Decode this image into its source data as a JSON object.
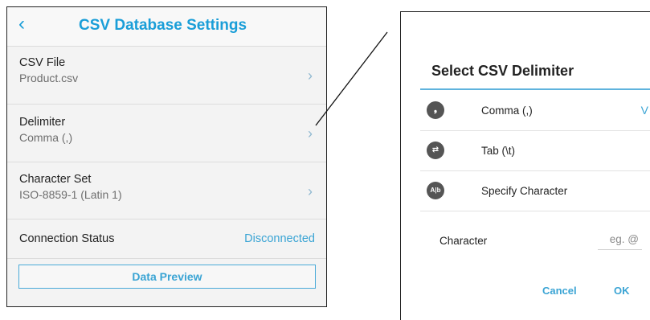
{
  "settings": {
    "title": "CSV Database Settings",
    "rows": [
      {
        "label": "CSV File",
        "value": "Product.csv"
      },
      {
        "label": "Delimiter",
        "value": "Comma (,)"
      },
      {
        "label": "Character Set",
        "value": "ISO-8859-1 (Latin 1)"
      }
    ],
    "connection": {
      "label": "Connection Status",
      "status": "Disconnected"
    },
    "preview_button": "Data Preview"
  },
  "dialog": {
    "title": "Select CSV Delimiter",
    "options": [
      {
        "label": "Comma (,)",
        "icon": "comma-icon",
        "selected_mark": "V"
      },
      {
        "label": "Tab (\\t)",
        "icon": "tab-icon",
        "selected_mark": ""
      },
      {
        "label": "Specify Character",
        "icon": "specify-character-icon",
        "selected_mark": ""
      }
    ],
    "character_label": "Character",
    "character_placeholder": "eg. @",
    "cancel_label": "Cancel",
    "ok_label": "OK"
  },
  "colors": {
    "accent": "#1a9ed8",
    "link": "#3aa4d4"
  }
}
